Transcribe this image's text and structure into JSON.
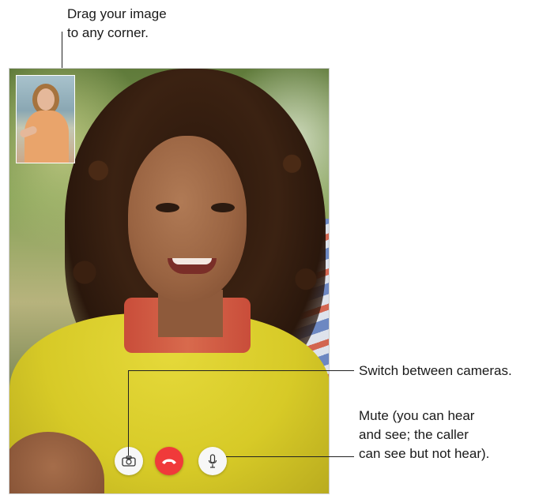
{
  "callouts": {
    "drag": "Drag your image\nto any corner.",
    "switch": "Switch between cameras.",
    "mute": "Mute (you can hear\nand see; the caller\ncan see but not hear)."
  },
  "controls": {
    "switch_icon": "camera-switch-icon",
    "end_icon": "phone-hang-up-icon",
    "mute_icon": "microphone-icon"
  },
  "colors": {
    "end_call": "#f03a3a",
    "button_bg": "#f7f7f7"
  }
}
